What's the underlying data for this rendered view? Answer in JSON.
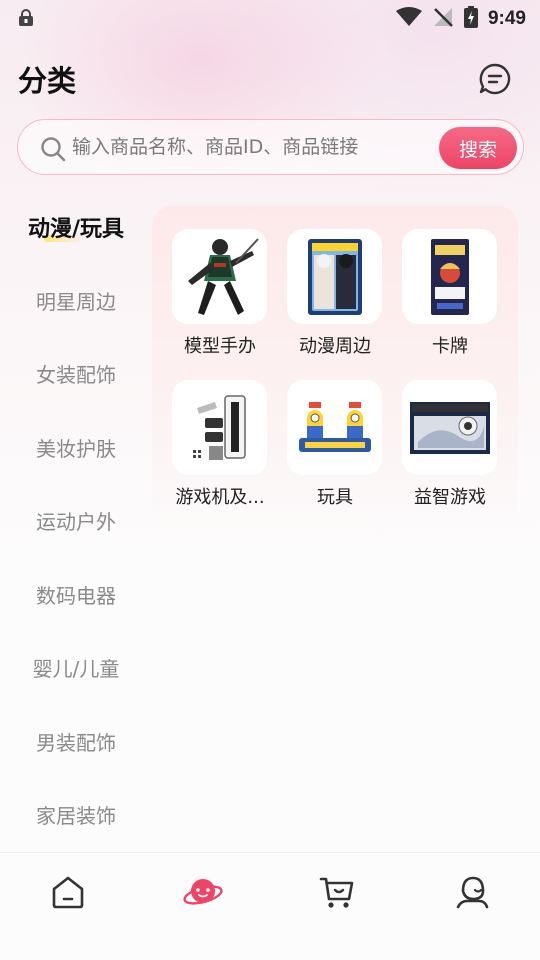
{
  "status_bar": {
    "time": "9:49"
  },
  "header": {
    "title": "分类"
  },
  "search": {
    "placeholder": "输入商品名称、商品ID、商品链接",
    "button_label": "搜索"
  },
  "sidebar": {
    "items": [
      {
        "label": "动漫/玩具",
        "active": true
      },
      {
        "label": "明星周边"
      },
      {
        "label": "女装配饰"
      },
      {
        "label": "美妆护肤"
      },
      {
        "label": "运动户外"
      },
      {
        "label": "数码电器"
      },
      {
        "label": "婴儿/儿童"
      },
      {
        "label": "男装配饰"
      },
      {
        "label": "家居装饰"
      }
    ]
  },
  "categories": [
    {
      "label": "模型手办",
      "icon": "figure-image"
    },
    {
      "label": "动漫周边",
      "icon": "anime-merch-image"
    },
    {
      "label": "卡牌",
      "icon": "card-pack-image"
    },
    {
      "label": "游戏机及...",
      "icon": "console-stand-image"
    },
    {
      "label": "玩具",
      "icon": "toy-image"
    },
    {
      "label": "益智游戏",
      "icon": "puzzle-image"
    }
  ],
  "bottom_nav": {
    "items": [
      {
        "name": "home",
        "icon": "home-icon"
      },
      {
        "name": "category",
        "icon": "planet-icon",
        "active": true
      },
      {
        "name": "cart",
        "icon": "cart-icon"
      },
      {
        "name": "profile",
        "icon": "user-icon"
      }
    ]
  },
  "colors": {
    "accent": "#ee4466",
    "active_nav": "#ee4466",
    "underline": "#ffe27a"
  }
}
